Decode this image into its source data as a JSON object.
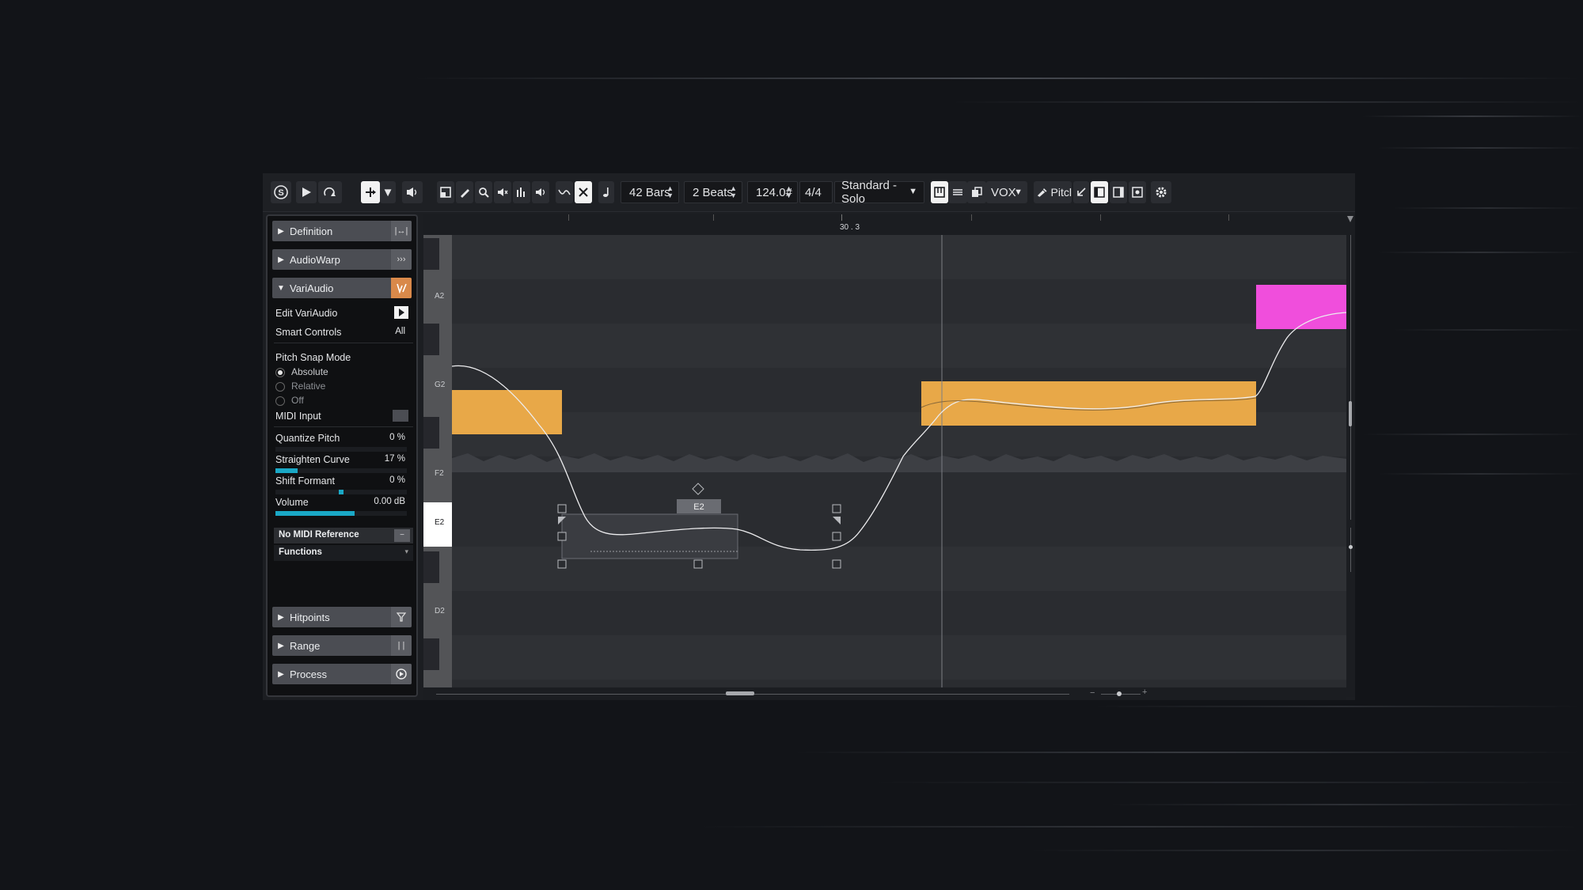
{
  "toolbar": {
    "length": "42 Bars",
    "grid": "2 Beats",
    "tempo": "124.0#",
    "signature": "4/4",
    "profile": "Standard - Solo",
    "track": "VOX",
    "pitch": "Pitcl"
  },
  "inspector": {
    "sections_top": [
      "Definition",
      "AudioWarp",
      "VariAudio"
    ],
    "edit_variaudio": "Edit VariAudio",
    "smart_controls": "Smart Controls",
    "smart_controls_value": "All",
    "pitch_snap_mode": "Pitch Snap Mode",
    "snap_absolute": "Absolute",
    "snap_relative": "Relative",
    "snap_off": "Off",
    "midi_input": "MIDI Input",
    "quantize_pitch": "Quantize Pitch",
    "quantize_pitch_value": "0 %",
    "quantize_pitch_level": 0,
    "straighten_curve": "Straighten Curve",
    "straighten_curve_value": "17 %",
    "straighten_curve_level": 0.17,
    "shift_formant": "Shift Formant",
    "shift_formant_value": "0 %",
    "volume": "Volume",
    "volume_value": "0.00 dB",
    "volume_level": 0.6,
    "midi_reference": "No MIDI Reference",
    "functions": "Functions",
    "sections_bottom": [
      "Hitpoints",
      "Range",
      "Process"
    ]
  },
  "editor": {
    "position_marker": "30 . 3",
    "key_labels": [
      "A2",
      "G2",
      "F2",
      "E2",
      "D2"
    ],
    "selected_segment_label": "E2",
    "colors": {
      "segment": "#e8a848",
      "segment_highlight": "#f04edc",
      "accent": "#1aa8c6",
      "variaudio_icon": "#d9894a"
    }
  }
}
